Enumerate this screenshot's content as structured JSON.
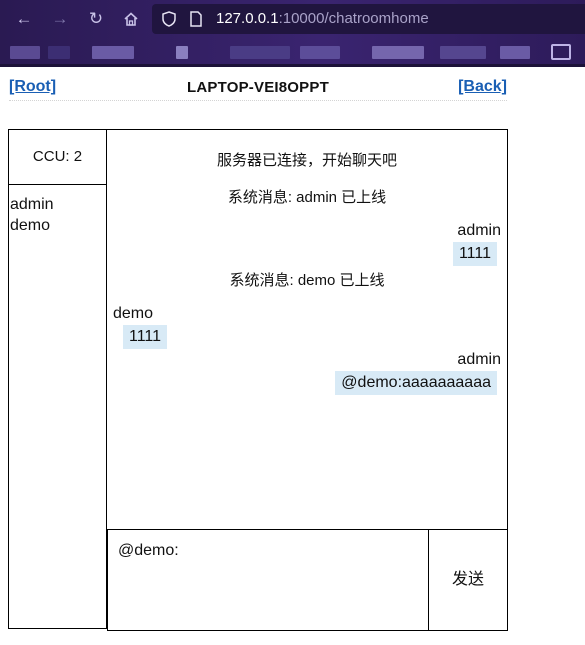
{
  "browser": {
    "url_host": "127.0.0.1",
    "url_rest": ":10000/chatroomhome"
  },
  "header": {
    "root_link": "[Root]",
    "host_title": "LAPTOP-VEI8OPPT",
    "back_link": "[Back]"
  },
  "sidebar": {
    "ccu": "CCU: 2",
    "users": [
      "admin",
      "demo"
    ]
  },
  "messages": {
    "sys_connected": "服务器已连接，开始聊天吧",
    "sys_admin_online": "系统消息: admin 已上线",
    "m1_sender": "admin",
    "m1_text": "1111",
    "sys_demo_online": "系统消息: demo 已上线",
    "m2_sender": "demo",
    "m2_text": "1111",
    "m3_sender": "admin",
    "m3_text": "@demo:aaaaaaaaaa"
  },
  "composer": {
    "value": "@demo:",
    "send_label": "发送"
  },
  "colors": {
    "chrome_bg": "#2a1a52",
    "bubble_bg": "#d8eaf6",
    "link": "#1a5fb4"
  }
}
